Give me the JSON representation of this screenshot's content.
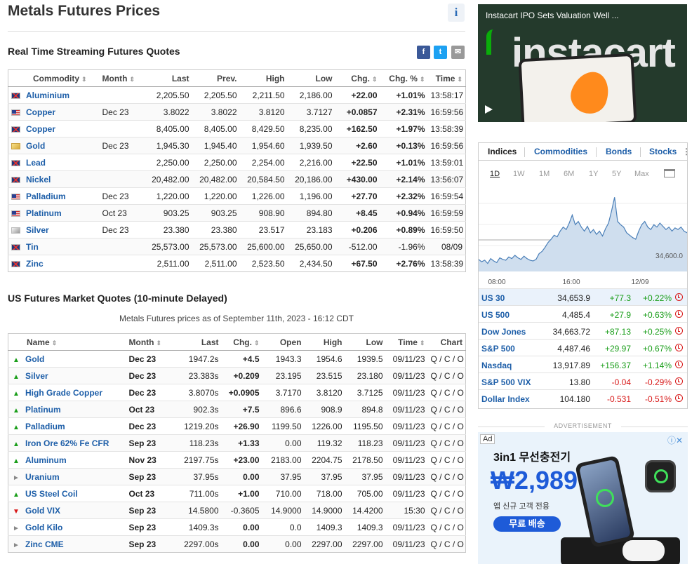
{
  "page": {
    "title": "Metals Futures Prices",
    "info_glyph": "i"
  },
  "realtime": {
    "title": "Real Time Streaming Futures Quotes",
    "share": [
      "f",
      "t",
      "✉"
    ],
    "headers": [
      "Commodity",
      "Month",
      "Last",
      "Prev.",
      "High",
      "Low",
      "Chg.",
      "Chg. %",
      "Time"
    ],
    "rows": [
      {
        "flag": "uk",
        "name": "Aluminium",
        "month": "",
        "last": "2,205.50",
        "prev": "2,205.50",
        "high": "2,211.50",
        "low": "2,186.00",
        "chg": "+22.00",
        "pct": "+1.01%",
        "time": "13:58:17",
        "dir": "pos"
      },
      {
        "flag": "us",
        "name": "Copper",
        "month": "Dec 23",
        "last": "3.8022",
        "prev": "3.8022",
        "high": "3.8120",
        "low": "3.7127",
        "chg": "+0.0857",
        "pct": "+2.31%",
        "time": "16:59:56",
        "dir": "pos"
      },
      {
        "flag": "uk",
        "name": "Copper",
        "month": "",
        "last": "8,405.00",
        "prev": "8,405.00",
        "high": "8,429.50",
        "low": "8,235.00",
        "chg": "+162.50",
        "pct": "+1.97%",
        "time": "13:58:39",
        "dir": "pos"
      },
      {
        "flag": "gold",
        "name": "Gold",
        "month": "Dec 23",
        "last": "1,945.30",
        "prev": "1,945.40",
        "high": "1,954.60",
        "low": "1,939.50",
        "chg": "+2.60",
        "pct": "+0.13%",
        "time": "16:59:56",
        "dir": "pos"
      },
      {
        "flag": "uk",
        "name": "Lead",
        "month": "",
        "last": "2,250.00",
        "prev": "2,250.00",
        "high": "2,254.00",
        "low": "2,216.00",
        "chg": "+22.50",
        "pct": "+1.01%",
        "time": "13:59:01",
        "dir": "pos"
      },
      {
        "flag": "uk",
        "name": "Nickel",
        "month": "",
        "last": "20,482.00",
        "prev": "20,482.00",
        "high": "20,584.50",
        "low": "20,186.00",
        "chg": "+430.00",
        "pct": "+2.14%",
        "time": "13:56:07",
        "dir": "pos"
      },
      {
        "flag": "us",
        "name": "Palladium",
        "month": "Dec 23",
        "last": "1,220.00",
        "prev": "1,220.00",
        "high": "1,226.00",
        "low": "1,196.00",
        "chg": "+27.70",
        "pct": "+2.32%",
        "time": "16:59:54",
        "dir": "pos"
      },
      {
        "flag": "us",
        "name": "Platinum",
        "month": "Oct 23",
        "last": "903.25",
        "prev": "903.25",
        "high": "908.90",
        "low": "894.80",
        "chg": "+8.45",
        "pct": "+0.94%",
        "time": "16:59:59",
        "dir": "pos"
      },
      {
        "flag": "silver",
        "name": "Silver",
        "month": "Dec 23",
        "last": "23.380",
        "prev": "23.380",
        "high": "23.517",
        "low": "23.183",
        "chg": "+0.206",
        "pct": "+0.89%",
        "time": "16:59:50",
        "dir": "pos"
      },
      {
        "flag": "uk",
        "name": "Tin",
        "month": "",
        "last": "25,573.00",
        "prev": "25,573.00",
        "high": "25,600.00",
        "low": "25,650.00",
        "chg": "-512.00",
        "pct": "-1.96%",
        "time": "08/09",
        "dir": "neg"
      },
      {
        "flag": "uk",
        "name": "Zinc",
        "month": "",
        "last": "2,511.00",
        "prev": "2,511.00",
        "high": "2,523.50",
        "low": "2,434.50",
        "chg": "+67.50",
        "pct": "+2.76%",
        "time": "13:58:39",
        "dir": "pos"
      }
    ]
  },
  "delayed": {
    "title": "US Futures Market Quotes (10-minute Delayed)",
    "note": "Metals Futures prices as of September 11th, 2023 - 16:12 CDT",
    "headers": [
      "Name",
      "Month",
      "Last",
      "Chg.",
      "Open",
      "High",
      "Low",
      "Time",
      "Chart"
    ],
    "chart_links": "Q / C / O",
    "rows": [
      {
        "arrow": "up",
        "name": "Gold",
        "month": "Dec 23",
        "last": "1947.2s",
        "chg": "+4.5",
        "open": "1943.3",
        "high": "1954.6",
        "low": "1939.5",
        "time": "09/11/23",
        "dir": "pos"
      },
      {
        "arrow": "up",
        "name": "Silver",
        "month": "Dec 23",
        "last": "23.383s",
        "chg": "+0.209",
        "open": "23.195",
        "high": "23.515",
        "low": "23.180",
        "time": "09/11/23",
        "dir": "pos"
      },
      {
        "arrow": "up",
        "name": "High Grade Copper",
        "month": "Dec 23",
        "last": "3.8070s",
        "chg": "+0.0905",
        "open": "3.7170",
        "high": "3.8120",
        "low": "3.7125",
        "time": "09/11/23",
        "dir": "pos"
      },
      {
        "arrow": "up",
        "name": "Platinum",
        "month": "Oct 23",
        "last": "902.3s",
        "chg": "+7.5",
        "open": "896.6",
        "high": "908.9",
        "low": "894.8",
        "time": "09/11/23",
        "dir": "pos"
      },
      {
        "arrow": "up",
        "name": "Palladium",
        "month": "Dec 23",
        "last": "1219.20s",
        "chg": "+26.90",
        "open": "1199.50",
        "high": "1226.00",
        "low": "1195.50",
        "time": "09/11/23",
        "dir": "pos"
      },
      {
        "arrow": "up",
        "name": "Iron Ore 62% Fe CFR",
        "month": "Sep 23",
        "last": "118.23s",
        "chg": "+1.33",
        "open": "0.00",
        "high": "119.32",
        "low": "118.23",
        "time": "09/11/23",
        "dir": "pos"
      },
      {
        "arrow": "up",
        "name": "Aluminum",
        "month": "Nov 23",
        "last": "2197.75s",
        "chg": "+23.00",
        "open": "2183.00",
        "high": "2204.75",
        "low": "2178.50",
        "time": "09/11/23",
        "dir": "pos"
      },
      {
        "arrow": "flat",
        "name": "Uranium",
        "month": "Sep 23",
        "last": "37.95s",
        "chg": "0.00",
        "open": "37.95",
        "high": "37.95",
        "low": "37.95",
        "time": "09/11/23",
        "dir": "neutral"
      },
      {
        "arrow": "up",
        "name": "US Steel Coil",
        "month": "Oct 23",
        "last": "711.00s",
        "chg": "+1.00",
        "open": "710.00",
        "high": "718.00",
        "low": "705.00",
        "time": "09/11/23",
        "dir": "pos"
      },
      {
        "arrow": "down",
        "name": "Gold VIX",
        "month": "Sep 23",
        "last": "14.5800",
        "chg": "-0.3605",
        "open": "14.9000",
        "high": "14.9000",
        "low": "14.4200",
        "time": "15:30",
        "dir": "neg"
      },
      {
        "arrow": "flat",
        "name": "Gold Kilo",
        "month": "Sep 23",
        "last": "1409.3s",
        "chg": "0.00",
        "open": "0.0",
        "high": "1409.3",
        "low": "1409.3",
        "time": "09/11/23",
        "dir": "neutral"
      },
      {
        "arrow": "flat",
        "name": "Zinc CME",
        "month": "Sep 23",
        "last": "2297.00s",
        "chg": "0.00",
        "open": "0.00",
        "high": "2297.00",
        "low": "2297.00",
        "time": "09/11/23",
        "dir": "neutral"
      }
    ]
  },
  "video": {
    "title": "Instacart IPO Sets Valuation Well ...",
    "brand": "instacart"
  },
  "widget": {
    "tabs": [
      "Indices",
      "Commodities",
      "Bonds",
      "Stocks"
    ],
    "ranges": [
      "1D",
      "1W",
      "1M",
      "6M",
      "1Y",
      "5Y",
      "Max"
    ],
    "active_range": "1D",
    "chart_data": {
      "type": "area",
      "x_ticks": [
        "08:00",
        "16:00",
        "12/09"
      ],
      "y_label": "34,600.0",
      "values": [
        0.15,
        0.12,
        0.14,
        0.1,
        0.16,
        0.13,
        0.11,
        0.17,
        0.15,
        0.14,
        0.18,
        0.16,
        0.2,
        0.17,
        0.15,
        0.19,
        0.16,
        0.14,
        0.13,
        0.15,
        0.22,
        0.25,
        0.3,
        0.36,
        0.4,
        0.45,
        0.43,
        0.5,
        0.55,
        0.52,
        0.6,
        0.7,
        0.58,
        0.62,
        0.55,
        0.5,
        0.56,
        0.48,
        0.52,
        0.46,
        0.5,
        0.44,
        0.53,
        0.6,
        0.75,
        0.92,
        0.62,
        0.58,
        0.55,
        0.48,
        0.45,
        0.42,
        0.4,
        0.5,
        0.58,
        0.62,
        0.55,
        0.52,
        0.58,
        0.55,
        0.6,
        0.56,
        0.52,
        0.55,
        0.5,
        0.54,
        0.52,
        0.55,
        0.5,
        0.48
      ]
    },
    "indices": [
      {
        "name": "US 30",
        "last": "34,653.9",
        "chg": "+77.3",
        "pct": "+0.22%",
        "dir": "pos"
      },
      {
        "name": "US 500",
        "last": "4,485.4",
        "chg": "+27.9",
        "pct": "+0.63%",
        "dir": "pos"
      },
      {
        "name": "Dow Jones",
        "last": "34,663.72",
        "chg": "+87.13",
        "pct": "+0.25%",
        "dir": "pos"
      },
      {
        "name": "S&P 500",
        "last": "4,487.46",
        "chg": "+29.97",
        "pct": "+0.67%",
        "dir": "pos"
      },
      {
        "name": "Nasdaq",
        "last": "13,917.89",
        "chg": "+156.37",
        "pct": "+1.14%",
        "dir": "pos"
      },
      {
        "name": "S&P 500 VIX",
        "last": "13.80",
        "chg": "-0.04",
        "pct": "-0.29%",
        "dir": "neg"
      },
      {
        "name": "Dollar Index",
        "last": "104.180",
        "chg": "-0.531",
        "pct": "-0.51%",
        "dir": "neg"
      }
    ]
  },
  "advertisement": {
    "label": "ADVERTISEMENT",
    "tag": "Ad",
    "close": "ⓘ✕",
    "headline": "3in1 무선충전기",
    "price": "₩2,989",
    "sub": "앱 신규 고객 전용",
    "cta": "무료 배송"
  }
}
